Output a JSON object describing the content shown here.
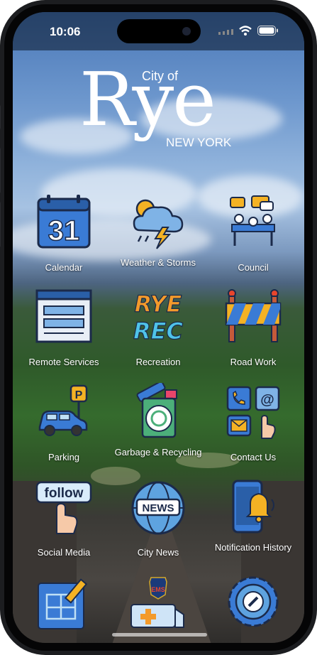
{
  "status_bar": {
    "time": "10:06"
  },
  "header": {
    "city_of": "City of",
    "city_name": "Rye",
    "state": "NEW YORK"
  },
  "tiles": [
    {
      "label": "Calendar",
      "icon": "calendar-icon",
      "icon_text": "31"
    },
    {
      "label": "Weather & Storms",
      "icon": "weather-storm-icon"
    },
    {
      "label": "Council",
      "icon": "council-meeting-icon"
    },
    {
      "label": "Remote Services",
      "icon": "browser-window-icon"
    },
    {
      "label": "Recreation",
      "icon": "rye-rec-icon",
      "icon_text_1": "RYE",
      "icon_text_2": "REC"
    },
    {
      "label": "Road Work",
      "icon": "road-barrier-icon"
    },
    {
      "label": "Parking",
      "icon": "parking-car-icon",
      "icon_text": "P"
    },
    {
      "label": "Garbage & Recycling",
      "icon": "recycling-bin-icon"
    },
    {
      "label": "Contact Us",
      "icon": "contact-phone-email-icon",
      "icon_text": "@"
    },
    {
      "label": "Social Media",
      "icon": "follow-button-icon",
      "icon_text": "follow"
    },
    {
      "label": "City News",
      "icon": "news-globe-icon",
      "icon_text": "NEWS"
    },
    {
      "label": "Notification History",
      "icon": "notification-bell-icon"
    },
    {
      "label": "",
      "icon": "blueprint-plans-icon"
    },
    {
      "label": "",
      "icon": "ems-ambulance-icon",
      "icon_text": "EMS"
    },
    {
      "label": "",
      "icon": "settings-wrench-gear-icon"
    }
  ],
  "colors": {
    "accent_blue": "#3a7bd5",
    "status_bar_bg": "#0a1628"
  }
}
